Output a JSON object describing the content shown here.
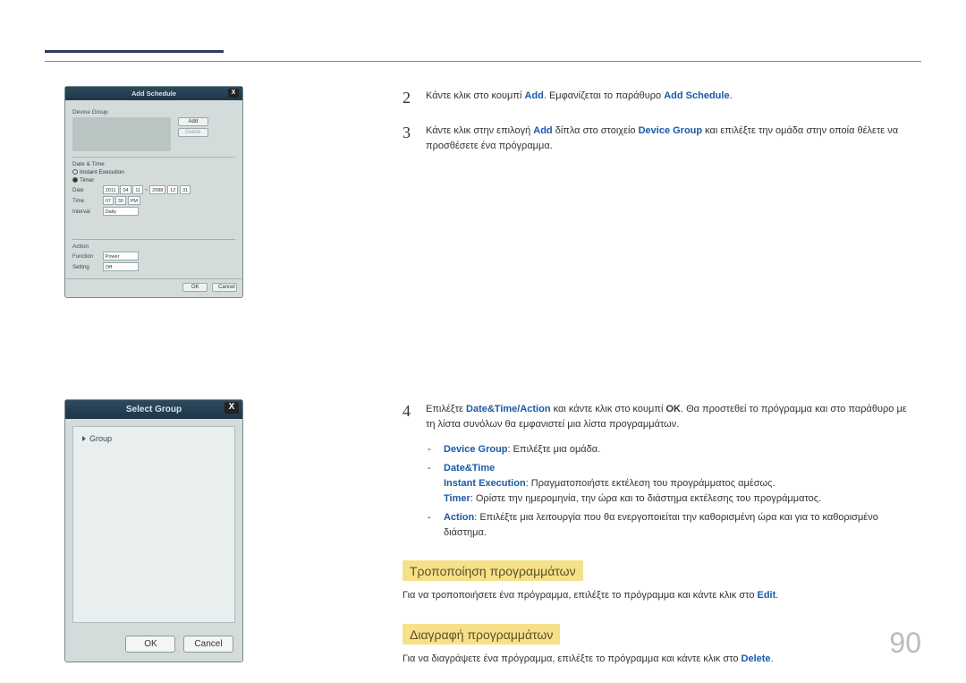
{
  "pageNumber": "90",
  "dlg1": {
    "title": "Add Schedule",
    "close": "X",
    "deviceGroup": "Device Group",
    "addBtn": "Add",
    "deleteBtn": "Delete",
    "dateTime": "Date & Time",
    "instantExec": "Instant Execution",
    "timer": "Timer",
    "dateLabel": "Date",
    "dateY1": "2011",
    "dateM1": "04",
    "dateD1": "11",
    "dateY2": "2088",
    "dateM2": "12",
    "dateD2": "31",
    "timeLabel": "Time",
    "timeH": "07",
    "timeM": "30",
    "timeAP": "PM",
    "intervalLabel": "Interval",
    "intervalVal": "Daily",
    "action": "Action",
    "functionLabel": "Function",
    "functionVal": "Power",
    "settingLabel": "Setting",
    "settingVal": "Off",
    "ok": "OK",
    "cancel": "Cancel"
  },
  "dlg2": {
    "title": "Select Group",
    "close": "X",
    "node": "Group",
    "ok": "OK",
    "cancel": "Cancel"
  },
  "step2": {
    "num": "2",
    "t1": "Κάντε κλικ στο κουμπί ",
    "add": "Add",
    "t2": ". Εμφανίζεται το παράθυρο ",
    "addSchedule": "Add Schedule",
    "t3": "."
  },
  "step3": {
    "num": "3",
    "t1": "Κάντε κλικ στην επιλογή ",
    "add": "Add",
    "t2": " δίπλα στο στοιχείο ",
    "devGroup": "Device Group",
    "t3": " και επιλέξτε την ομάδα στην οποία θέλετε να προσθέσετε ένα πρόγραμμα."
  },
  "step4": {
    "num": "4",
    "t1": "Επιλέξτε ",
    "dta": "Date&Time/Action",
    "t2": " και κάντε κλικ στο κουμπί ",
    "ok": "OK",
    "t3": ". Θα προστεθεί το πρόγραμμα και στο παράθυρο με τη λίστα συνόλων θα εμφανιστεί μια λίστα προγραμμάτων."
  },
  "bullets": {
    "b1a": "Device Group",
    "b1b": ": Επιλέξτε μια ομάδα.",
    "b2a": "Date&Time",
    "b2b": "Instant Execution",
    "b2c": ": Πραγματοποιήστε εκτέλεση του προγράμματος αμέσως.",
    "b2d": "Timer",
    "b2e": ": Ορίστε την ημερομηνία, την ώρα και το διάστημα εκτέλεσης του προγράμματος.",
    "b3a": "Action",
    "b3b": ": Επιλέξτε μια λειτουργία που θα ενεργοποιείται την καθορισμένη ώρα και για το καθορισμένο διάστημα."
  },
  "h1": "Τροποποίηση προγραμμάτων",
  "p1a": "Για να τροποποιήσετε ένα πρόγραμμα, επιλέξτε το πρόγραμμα και κάντε κλικ στο ",
  "p1b": "Edit",
  "p1c": ".",
  "h2": "Διαγραφή προγραμμάτων",
  "p2a": "Για να διαγράψετε ένα πρόγραμμα, επιλέξτε το πρόγραμμα και κάντε κλικ στο ",
  "p2b": "Delete",
  "p2c": "."
}
